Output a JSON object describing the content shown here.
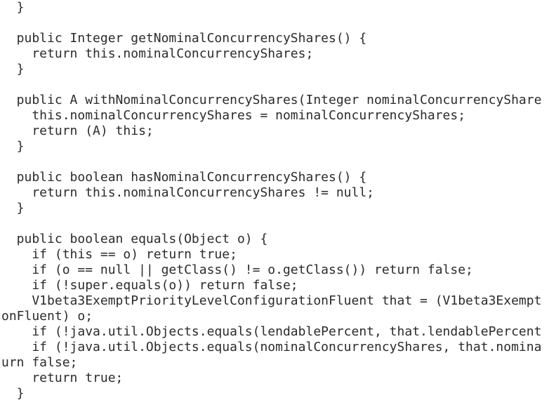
{
  "code": {
    "lines": [
      "  }",
      "",
      "  public Integer getNominalConcurrencyShares() {",
      "    return this.nominalConcurrencyShares;",
      "  }",
      "",
      "  public A withNominalConcurrencyShares(Integer nominalConcurrencyShare",
      "    this.nominalConcurrencyShares = nominalConcurrencyShares;",
      "    return (A) this;",
      "  }",
      "",
      "  public boolean hasNominalConcurrencyShares() {",
      "    return this.nominalConcurrencyShares != null;",
      "  }",
      "",
      "  public boolean equals(Object o) {",
      "    if (this == o) return true;",
      "    if (o == null || getClass() != o.getClass()) return false;",
      "    if (!super.equals(o)) return false;",
      "    V1beta3ExemptPriorityLevelConfigurationFluent that = (V1beta3Exempt",
      "onFluent) o;",
      "    if (!java.util.Objects.equals(lendablePercent, that.lendablePercent",
      "    if (!java.util.Objects.equals(nominalConcurrencyShares, that.nomina",
      "urn false;",
      "    return true;",
      "  }"
    ]
  }
}
